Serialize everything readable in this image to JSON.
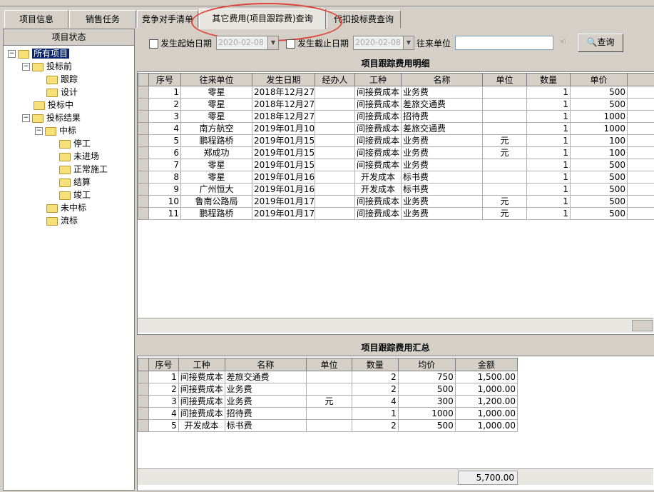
{
  "tabs": [
    {
      "label": "项目信息"
    },
    {
      "label": "销售任务"
    },
    {
      "label": "竞争对手清单"
    },
    {
      "label": "其它费用(项目跟踪费)查询"
    },
    {
      "label": "代扣投标费查询"
    }
  ],
  "sidebar": {
    "title": "项目状态",
    "tree": [
      {
        "label": "所有项目"
      },
      {
        "label": "投标前"
      },
      {
        "label": "跟踪"
      },
      {
        "label": "设计"
      },
      {
        "label": "投标中"
      },
      {
        "label": "投标结果"
      },
      {
        "label": "中标"
      },
      {
        "label": "停工"
      },
      {
        "label": "未进场"
      },
      {
        "label": "正常施工"
      },
      {
        "label": "结算"
      },
      {
        "label": "竣工"
      },
      {
        "label": "未中标"
      },
      {
        "label": "流标"
      }
    ]
  },
  "filters": {
    "start_label": "发生起始日期",
    "start_value": "2020-02-08",
    "end_label": "发生截止日期",
    "end_value": "2020-02-08",
    "unit_label": "往来单位",
    "unit_value": "",
    "query_label": "查询"
  },
  "detail": {
    "title": "项目跟踪费用明细",
    "headers": [
      "序号",
      "往来单位",
      "发生日期",
      "经办人",
      "工种",
      "名称",
      "单位",
      "数量",
      "单价"
    ],
    "rows": [
      [
        "1",
        "零星",
        "2018年12月27日",
        "",
        "间接费成本",
        "业务费",
        "",
        "1",
        "500"
      ],
      [
        "2",
        "零星",
        "2018年12月27日",
        "",
        "间接费成本",
        "差旅交通费",
        "",
        "1",
        "500"
      ],
      [
        "3",
        "零星",
        "2018年12月27日",
        "",
        "间接费成本",
        "招待费",
        "",
        "1",
        "1000"
      ],
      [
        "4",
        "南方航空",
        "2019年01月10日",
        "",
        "间接费成本",
        "差旅交通费",
        "",
        "1",
        "1000"
      ],
      [
        "5",
        "鹏程路桥",
        "2019年01月15日",
        "",
        "间接费成本",
        "业务费",
        "元",
        "1",
        "100"
      ],
      [
        "6",
        "郑成功",
        "2019年01月15日",
        "",
        "间接费成本",
        "业务费",
        "元",
        "1",
        "100"
      ],
      [
        "7",
        "零星",
        "2019年01月15日",
        "",
        "间接费成本",
        "业务费",
        "",
        "1",
        "500"
      ],
      [
        "8",
        "零星",
        "2019年01月16日",
        "",
        "开发成本",
        "标书费",
        "",
        "1",
        "500"
      ],
      [
        "9",
        "广州恒大",
        "2019年01月16日",
        "",
        "开发成本",
        "标书费",
        "",
        "1",
        "500"
      ],
      [
        "10",
        "鲁南公路局",
        "2019年01月17日",
        "",
        "间接费成本",
        "业务费",
        "元",
        "1",
        "500"
      ],
      [
        "11",
        "鹏程路桥",
        "2019年01月17日",
        "",
        "间接费成本",
        "业务费",
        "元",
        "1",
        "500"
      ]
    ]
  },
  "summary": {
    "title": "项目跟踪费用汇总",
    "headers": [
      "序号",
      "工种",
      "名称",
      "单位",
      "数量",
      "均价",
      "金额"
    ],
    "rows": [
      [
        "1",
        "间接费成本",
        "差旅交通费",
        "",
        "2",
        "750",
        "1,500.00"
      ],
      [
        "2",
        "间接费成本",
        "业务费",
        "",
        "2",
        "500",
        "1,000.00"
      ],
      [
        "3",
        "间接费成本",
        "业务费",
        "元",
        "4",
        "300",
        "1,200.00"
      ],
      [
        "4",
        "间接费成本",
        "招待费",
        "",
        "1",
        "1000",
        "1,000.00"
      ],
      [
        "5",
        "开发成本",
        "标书费",
        "",
        "2",
        "500",
        "1,000.00"
      ]
    ],
    "total": "5,700.00"
  },
  "colors": {
    "highlight_circle": "#e0453c",
    "selection": "#0a246a"
  }
}
